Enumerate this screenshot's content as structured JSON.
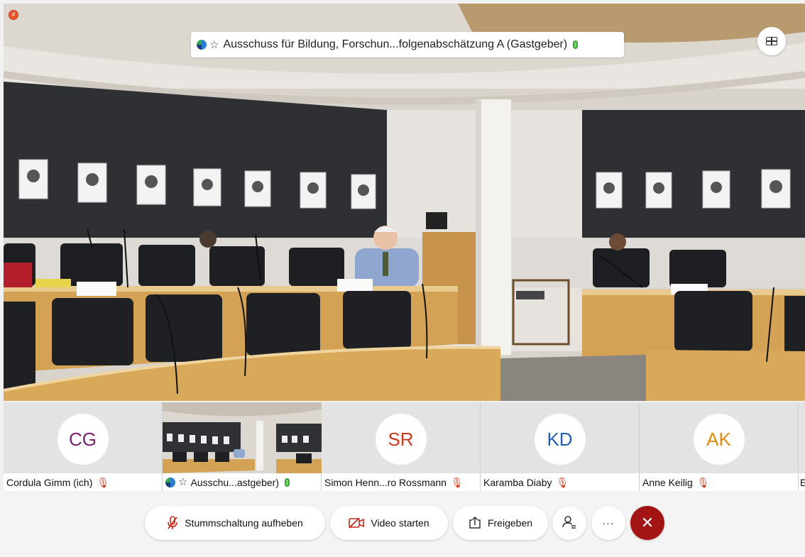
{
  "meeting": {
    "title": "Ausschuss für Bildung, Forschun...folgenabschätzung A (Gastgeber)",
    "recording_badge": "#"
  },
  "participants": [
    {
      "initials": "CG",
      "name": "Cordula Gimm (ich)",
      "color": "#7a1f6e",
      "mic": "muted"
    },
    {
      "initials": "",
      "name": "Ausschu...astgeber)",
      "color": "",
      "mic": "active",
      "video": true
    },
    {
      "initials": "SR",
      "name": "Simon Henn...ro Rossmann",
      "color": "#c9381c",
      "mic": "muted"
    },
    {
      "initials": "KD",
      "name": "Karamba Diaby",
      "color": "#2760b0",
      "mic": "muted"
    },
    {
      "initials": "AK",
      "name": "Anne Keilig",
      "color": "#e38a12",
      "mic": "muted"
    },
    {
      "initials": "",
      "name": "E",
      "color": "",
      "mic": ""
    }
  ],
  "controls": {
    "unmute": "Stummschaltung aufheben",
    "start_video": "Video starten",
    "share": "Freigeben",
    "more": "···",
    "end": "✕"
  },
  "colors": {
    "end_call": "#a31515",
    "mic_muted": "#d4351c",
    "mic_active": "#3aa535"
  }
}
